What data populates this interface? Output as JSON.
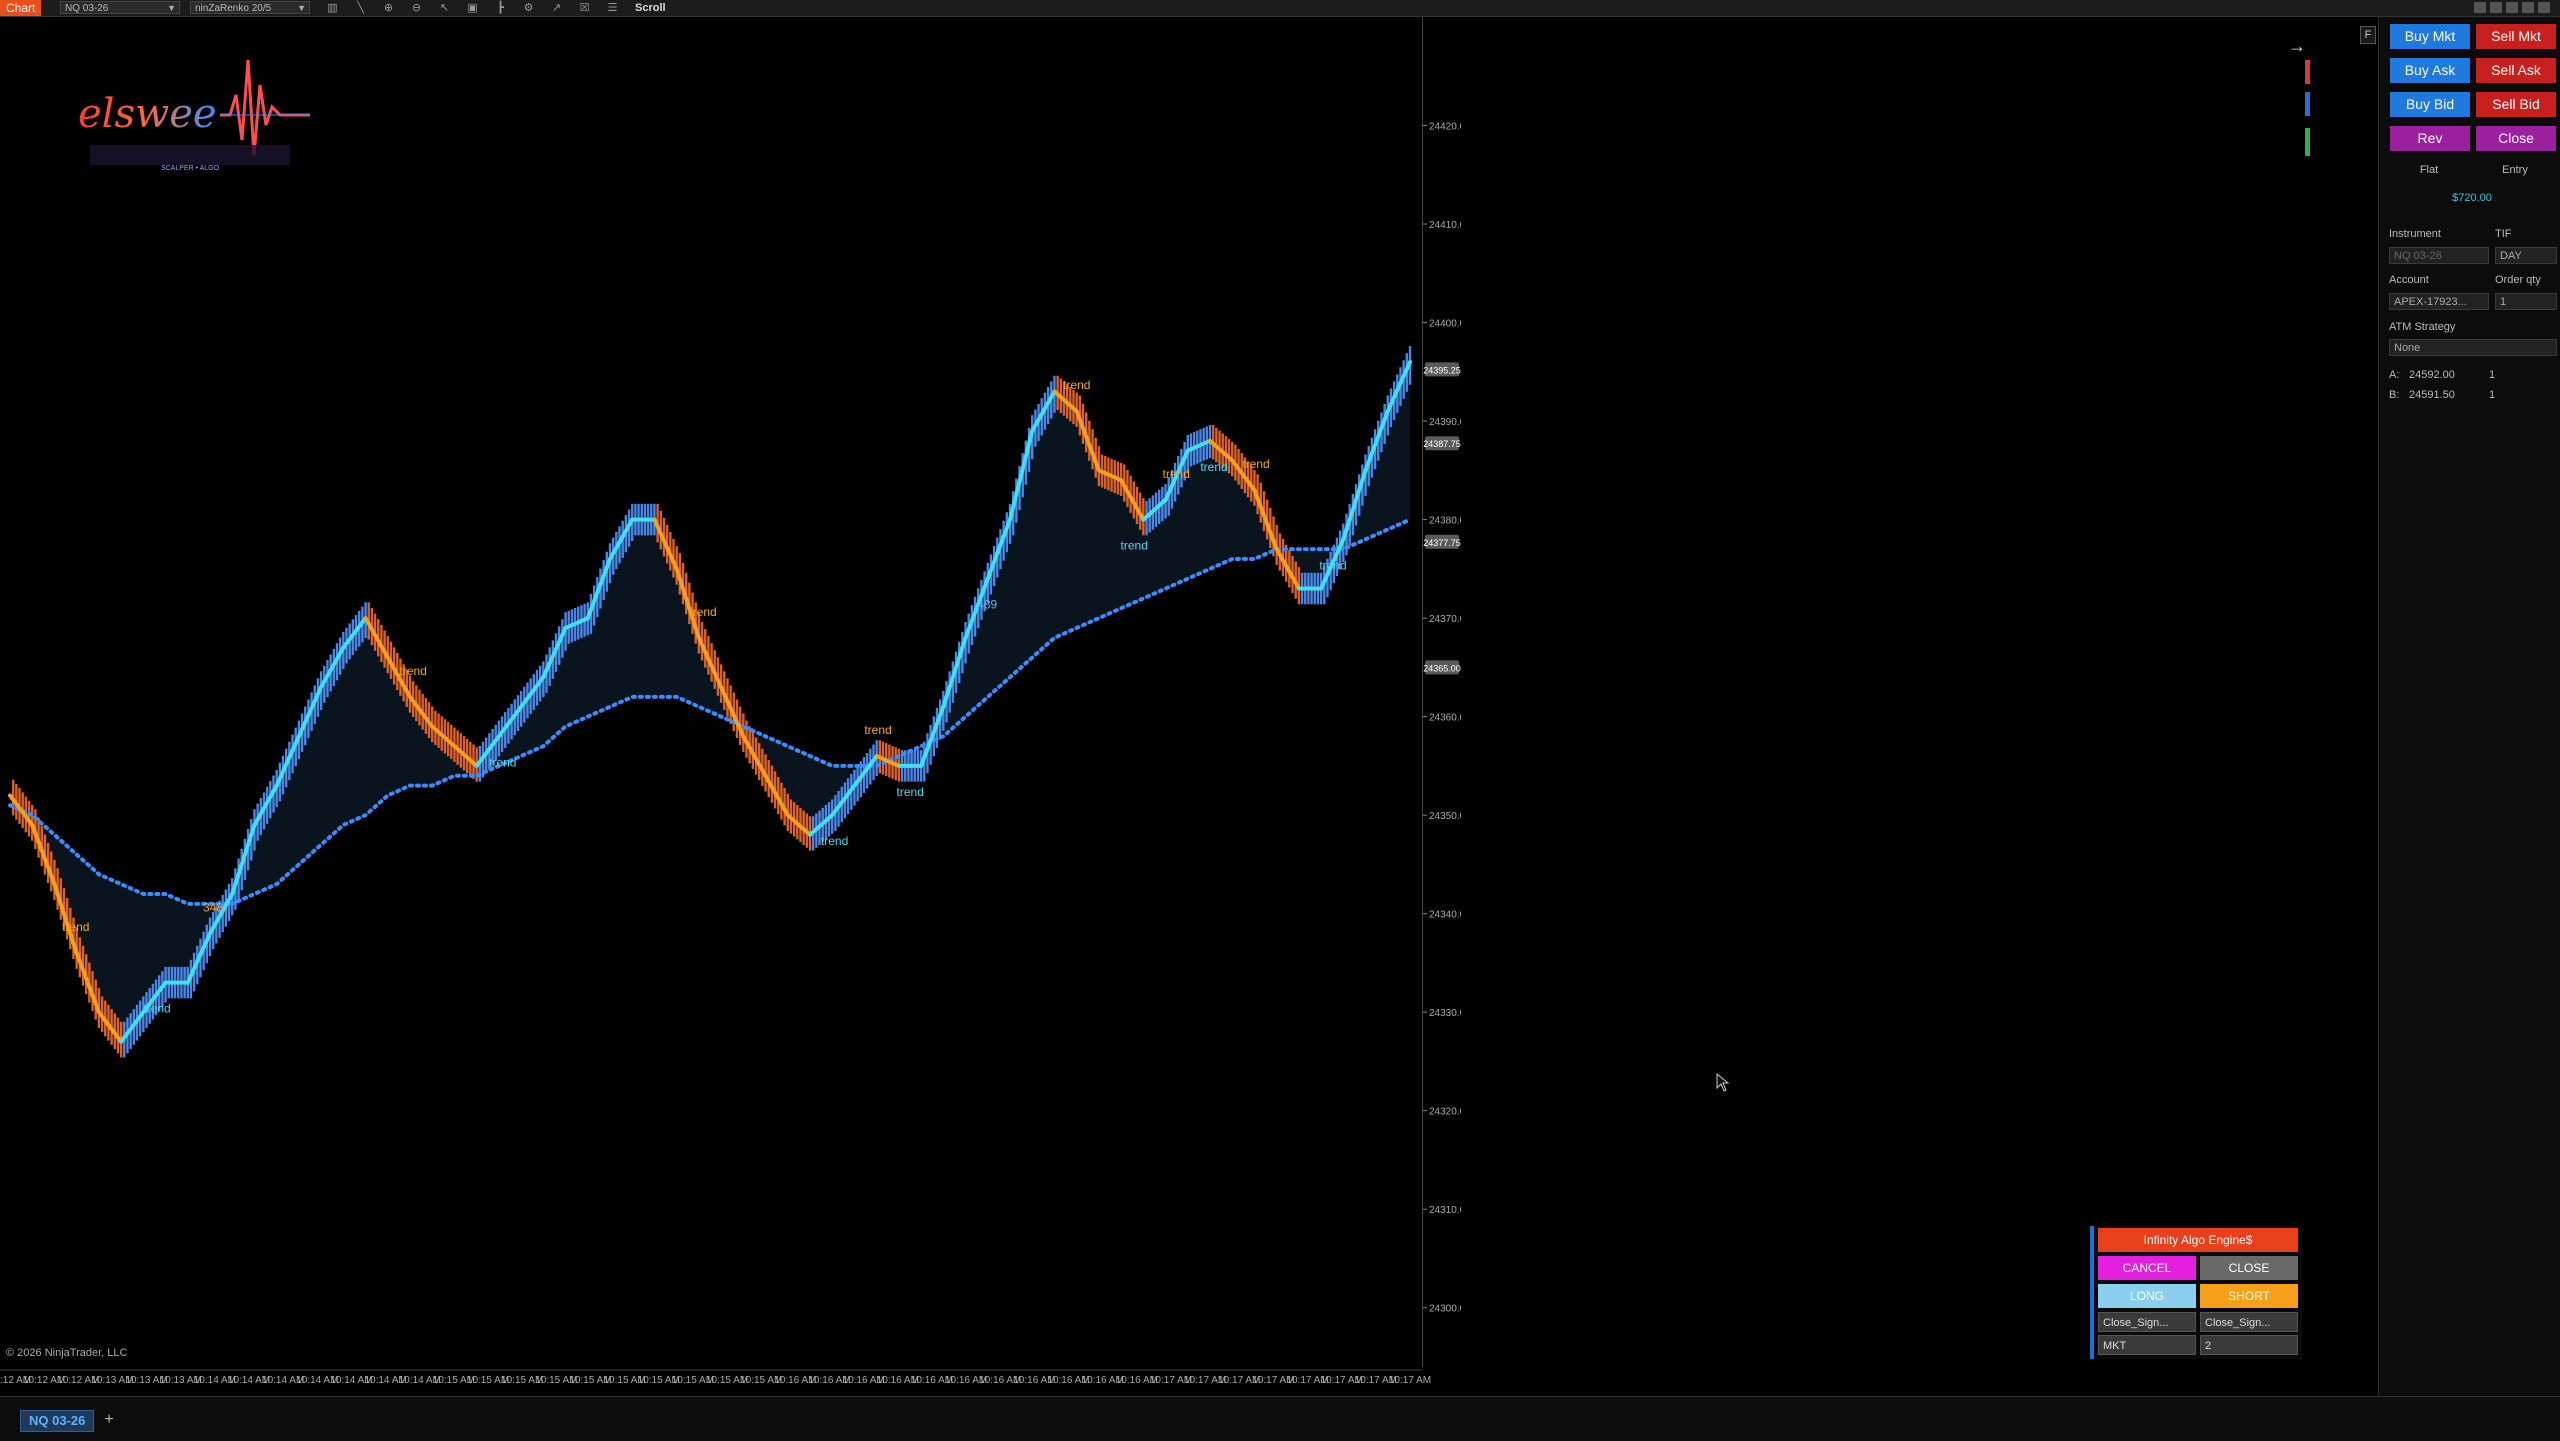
{
  "toolbar": {
    "tab_label": "Chart",
    "instrument": "NQ 03-26",
    "bar_type": "ninZaRenko 20/5",
    "scroll_label": "Scroll"
  },
  "copyright": "© 2026 NinjaTrader, LLC",
  "bottom": {
    "instrument_tab": "NQ 03-26",
    "add_tab": "+"
  },
  "logo": {
    "text": "elswee",
    "subtitle": "SCALPER • ALGO"
  },
  "chart_data": {
    "type": "candlestick",
    "series": [
      {
        "name": "close",
        "values": [
          24352,
          24349,
          24343,
          24336,
          24330,
          24327,
          24330,
          24333,
          24333,
          24338,
          24342,
          24349,
          24353,
          24358,
          24363,
          24367,
          24370,
          24366,
          24362,
          24359,
          24357,
          24355,
          24358,
          24361,
          24364,
          24369,
          24370,
          24376,
          24380,
          24380,
          24375,
          24368,
          24363,
          24358,
          24354,
          24350,
          24348,
          24350,
          24353,
          24356,
          24355,
          24355,
          24361,
          24368,
          24374,
          24380,
          24389,
          24393,
          24391,
          24385,
          24384,
          24380,
          24382,
          24387,
          24388,
          24386,
          24383,
          24377,
          24373,
          24373,
          24378,
          24385,
          24391,
          24396
        ]
      },
      {
        "name": "ema",
        "values": [
          24351,
          24350,
          24348,
          24346,
          24344,
          24343,
          24342,
          24342,
          24341,
          24341,
          24341,
          24342,
          24343,
          24345,
          24347,
          24349,
          24350,
          24352,
          24353,
          24353,
          24354,
          24354,
          24355,
          24356,
          24357,
          24359,
          24360,
          24361,
          24362,
          24362,
          24362,
          24361,
          24360,
          24359,
          24358,
          24357,
          24356,
          24355,
          24355,
          24355,
          24356,
          24357,
          24358,
          24360,
          24362,
          24364,
          24366,
          24368,
          24369,
          24370,
          24371,
          24372,
          24373,
          24374,
          24375,
          24376,
          24376,
          24377,
          24377,
          24377,
          24377,
          24378,
          24379,
          24380
        ]
      }
    ],
    "ylim": [
      24295,
      24430
    ],
    "y_ticks": [
      "24420.00",
      "24410.00",
      "24400.00",
      "24390.00",
      "24380.00",
      "24370.00",
      "24360.00",
      "24350.00",
      "24340.00",
      "24330.00",
      "24320.00",
      "24310.00",
      "24300.00"
    ],
    "price_tags": [
      {
        "label": "24395.25",
        "value": 24395.25,
        "color": "#5a5a5a"
      },
      {
        "label": "24387.75",
        "value": 24387.75,
        "color": "#5a5a5a"
      },
      {
        "label": "24377.75",
        "value": 24377.75,
        "color": "#5a5a5a"
      },
      {
        "label": "24365.00",
        "value": 24365.0,
        "color": "#5a5a5a"
      }
    ],
    "x_ticks": [
      "10:12 AM",
      "10:12 AM",
      "10:12 AM",
      "10:13 AM",
      "10:13 AM",
      "10:13 AM",
      "10:14 AM",
      "10:14 AM",
      "10:14 AM",
      "10:14 AM",
      "10:14 AM",
      "10:14 AM",
      "10:14 AM",
      "10:15 AM",
      "10:15 AM",
      "10:15 AM",
      "10:15 AM",
      "10:15 AM",
      "10:15 AM",
      "10:15 AM",
      "10:15 AM",
      "10:15 AM",
      "10:15 AM",
      "10:16 AM",
      "10:16 AM",
      "10:16 AM",
      "10:16 AM",
      "10:16 AM",
      "10:16 AM",
      "10:16 AM",
      "10:16 AM",
      "10:16 AM",
      "10:16 AM",
      "10:16 AM",
      "10:17 AM",
      "10:17 AM",
      "10:17 AM",
      "10:17 AM",
      "10:17 AM",
      "10:17 AM",
      "10:17 AM",
      "10:17 AM"
    ],
    "annotations": [
      {
        "text": "trend",
        "x": 0.047,
        "color": "#f2a81d"
      },
      {
        "text": "trend",
        "x": 0.288,
        "color": "#f2a81d"
      },
      {
        "text": "trend",
        "x": 0.495,
        "color": "#f2a81d"
      },
      {
        "text": "trend",
        "x": 0.62,
        "color": "#f2a81d"
      },
      {
        "text": "trend",
        "x": 0.762,
        "color": "#f2a81d"
      },
      {
        "text": "trend",
        "x": 0.833,
        "color": "#f2a81d"
      },
      {
        "text": "trend",
        "x": 0.89,
        "color": "#f2a81d"
      },
      {
        "text": "trend",
        "x": 0.105,
        "color": "#4fd8ee"
      },
      {
        "text": "trend",
        "x": 0.352,
        "color": "#4fd8ee"
      },
      {
        "text": "trend",
        "x": 0.589,
        "color": "#4fd8ee"
      },
      {
        "text": "trend",
        "x": 0.643,
        "color": "#4fd8ee"
      },
      {
        "text": "trend",
        "x": 0.803,
        "color": "#4fd8ee"
      },
      {
        "text": "trend",
        "x": 0.86,
        "color": "#4fd8ee"
      },
      {
        "text": "trend",
        "x": 0.945,
        "color": "#4fd8ee"
      },
      {
        "text": "348",
        "x": 0.145,
        "color": "#f2a81d"
      },
      {
        "text": "489",
        "x": 0.698,
        "color": "#5db3ff"
      }
    ],
    "grid": false
  },
  "panel": {
    "buy_mkt": "Buy Mkt",
    "sell_mkt": "Sell Mkt",
    "buy_ask": "Buy Ask",
    "sell_ask": "Sell Ask",
    "buy_bid": "Buy Bid",
    "sell_bid": "Sell Bid",
    "rev": "Rev",
    "close": "Close",
    "flat": "Flat",
    "entry": "Entry",
    "pnl": "$720.00",
    "instrument_label": "Instrument",
    "instrument_value": "NQ 03-26",
    "tif_label": "TIF",
    "tif_value": "DAY",
    "account_label": "Account",
    "account_value": "APEX-17923...",
    "qty_label": "Order qty",
    "qty_value": "1",
    "atm_label": "ATM Strategy",
    "atm_value": "None",
    "ask_label": "A:",
    "ask_price": "24592.00",
    "ask_qty": "1",
    "bid_label": "B:",
    "bid_price": "24591.50",
    "bid_qty": "1"
  },
  "algo": {
    "title": "Infinity Algo Engine$",
    "cancel": "CANCEL",
    "close": "CLOSE",
    "long": "LONG",
    "short": "SHORT",
    "left_signal": "Close_Sign...",
    "right_signal": "Close_Sign...",
    "order_type": "MKT",
    "qty": "2"
  },
  "colors": {
    "accent": "#e8501b",
    "up": "#4a86e8",
    "down": "#e0602a",
    "trend_up": "#3fe0f0",
    "trend_down": "#f6a019"
  }
}
